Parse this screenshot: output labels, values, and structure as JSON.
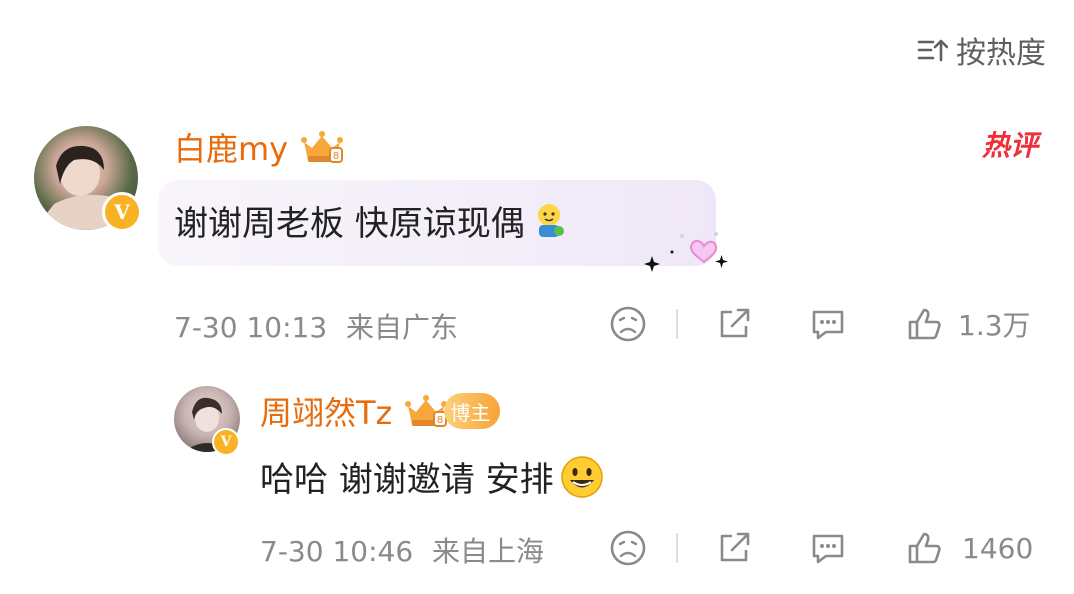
{
  "sort": {
    "label": "按热度"
  },
  "comments": [
    {
      "name": "白鹿my",
      "text": "谢谢周老板 快原谅现偶",
      "hot_badge": "热评",
      "time": "7-30 10:13",
      "location": "来自广东",
      "likes": "1.3万"
    }
  ],
  "reply": {
    "name": "周翊然Tz",
    "badge": "博主",
    "text": "哈哈 谢谢邀请 安排",
    "time": "7-30 10:46",
    "location": "来自上海",
    "likes": "1460"
  },
  "colors": {
    "name": "#e86b0c",
    "hot": "#ef2f3a",
    "meta": "#8a8a8a",
    "vip": "#f8b324"
  },
  "icons": [
    "sort-icon",
    "crown-badge-icon",
    "v-verified-icon",
    "emoji-sad-icon",
    "share-icon",
    "comment-icon",
    "like-icon",
    "smile-emoji-icon",
    "doll-emoji-icon",
    "heart-sparkle-icon"
  ]
}
